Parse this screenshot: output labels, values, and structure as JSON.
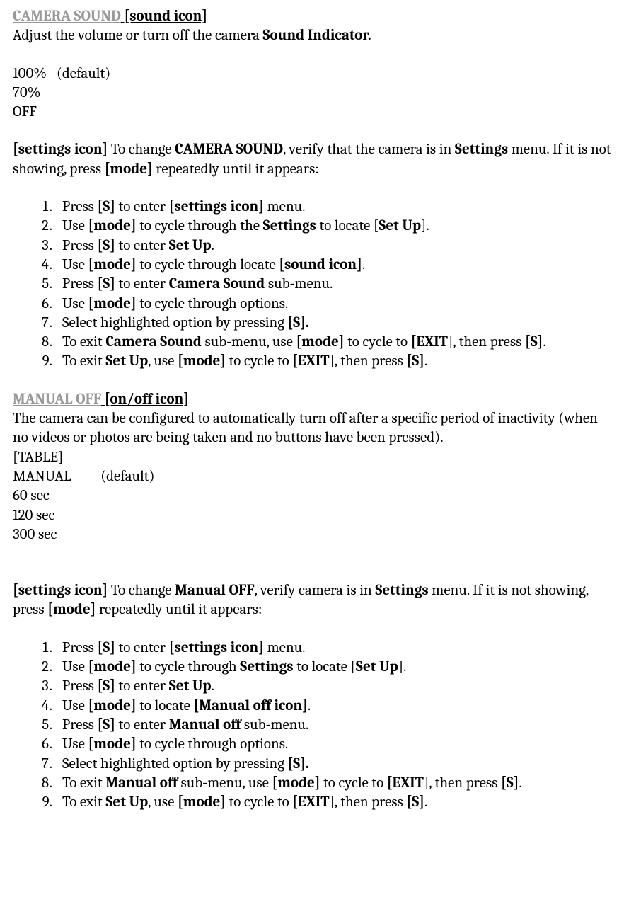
{
  "section1": {
    "title": "CAMERA SOUND",
    "title_icon": " [sound icon]",
    "desc_before": "Adjust the volume or turn off the camera ",
    "desc_bold": "Sound Indicator.",
    "options": [
      {
        "label": "100%",
        "note": "   (default)"
      },
      {
        "label": "70%",
        "note": ""
      },
      {
        "label": "OFF",
        "note": ""
      }
    ],
    "instr_icon": "[settings icon]",
    "instr_1": " To change ",
    "instr_b1": "CAMERA SOUND",
    "instr_2": ", verify that the camera is in ",
    "instr_b2": "Settings",
    "instr_3": " menu. If it is not showing, press ",
    "instr_b3": "[mode]",
    "instr_4": " repeatedly until it appears:",
    "steps": [
      {
        "parts": [
          "Press ",
          {
            "b": "[S]"
          },
          " to enter ",
          {
            "b": "[settings icon]"
          },
          " menu."
        ]
      },
      {
        "parts": [
          "Use ",
          {
            "b": "[mode]"
          },
          " to cycle through the ",
          {
            "b": "Settings"
          },
          " to locate [",
          {
            "b": "Set Up"
          },
          "]."
        ]
      },
      {
        "parts": [
          "Press ",
          {
            "b": "[S]"
          },
          " to enter ",
          {
            "b": "Set Up"
          },
          "."
        ]
      },
      {
        "parts": [
          "Use ",
          {
            "b": "[mode]"
          },
          " to cycle through locate ",
          {
            "b": "[sound icon]"
          },
          "."
        ]
      },
      {
        "parts": [
          "Press ",
          {
            "b": "[S]"
          },
          " to enter ",
          {
            "b": "Camera Sound"
          },
          " sub-menu."
        ]
      },
      {
        "parts": [
          "Use ",
          {
            "b": "[mode]"
          },
          " to cycle through options."
        ]
      },
      {
        "parts": [
          "Select highlighted option by pressing ",
          {
            "b": "[S]."
          }
        ]
      },
      {
        "parts": [
          "To exit ",
          {
            "b": "Camera Sound"
          },
          " sub-menu, use ",
          {
            "b": "[mode]"
          },
          " to cycle to ",
          {
            "b": "[EXIT"
          },
          "], then press ",
          {
            "b": "[S]"
          },
          "."
        ]
      },
      {
        "parts": [
          "To exit ",
          {
            "b": "Set Up"
          },
          ", use ",
          {
            "b": "[mode]"
          },
          " to cycle to ",
          {
            "b": "[EXIT"
          },
          "], then press ",
          {
            "b": "[S]"
          },
          "."
        ]
      }
    ]
  },
  "section2": {
    "title": "MANUAL OFF",
    "title_icon": " [on/off icon]",
    "desc": "The camera can be configured to automatically turn off after a specific period of inactivity (when no videos or photos are being taken and no buttons have been pressed).",
    "table_label": "[TABLE]",
    "options": [
      {
        "label": "MANUAL",
        "note": "         (default)"
      },
      {
        "label": "60 sec",
        "note": ""
      },
      {
        "label": "120 sec",
        "note": ""
      },
      {
        "label": "300 sec",
        "note": ""
      }
    ],
    "instr_icon": "[settings icon]",
    "instr_1": " To change ",
    "instr_b1": "Manual OFF",
    "instr_2": ", verify camera is in ",
    "instr_b2": "Settings",
    "instr_3": " menu. If it is not showing, press ",
    "instr_b3": "[mode]",
    "instr_4": " repeatedly until it appears:",
    "steps": [
      {
        "parts": [
          "Press ",
          {
            "b": "[S]"
          },
          " to enter ",
          {
            "b": "[settings icon]"
          },
          " menu."
        ]
      },
      {
        "parts": [
          "Use ",
          {
            "b": "[mode]"
          },
          " to cycle through ",
          {
            "b": "Settings"
          },
          " to locate [",
          {
            "b": "Set Up"
          },
          "]."
        ]
      },
      {
        "parts": [
          "Press ",
          {
            "b": "[S]"
          },
          " to enter ",
          {
            "b": "Set Up"
          },
          "."
        ]
      },
      {
        "parts": [
          "Use ",
          {
            "b": "[mode]"
          },
          " to locate ",
          {
            "b": "[Manual off icon]"
          },
          "."
        ]
      },
      {
        "parts": [
          "Press ",
          {
            "b": "[S]"
          },
          " to enter ",
          {
            "b": "Manual off"
          },
          " sub-menu."
        ]
      },
      {
        "parts": [
          "Use ",
          {
            "b": "[mode]"
          },
          " to cycle through options."
        ]
      },
      {
        "parts": [
          "Select highlighted option by pressing ",
          {
            "b": "[S]."
          }
        ]
      },
      {
        "parts": [
          "To exit ",
          {
            "b": "Manual off"
          },
          " sub-menu, use ",
          {
            "b": "[mode]"
          },
          " to cycle to ",
          {
            "b": "[EXIT"
          },
          "], then press ",
          {
            "b": "[S]"
          },
          "."
        ]
      },
      {
        "parts": [
          "To exit ",
          {
            "b": "Set Up"
          },
          ", use ",
          {
            "b": "[mode]"
          },
          " to cycle to ",
          {
            "b": "[EXIT"
          },
          "], then press ",
          {
            "b": "[S]"
          },
          "."
        ]
      }
    ]
  }
}
